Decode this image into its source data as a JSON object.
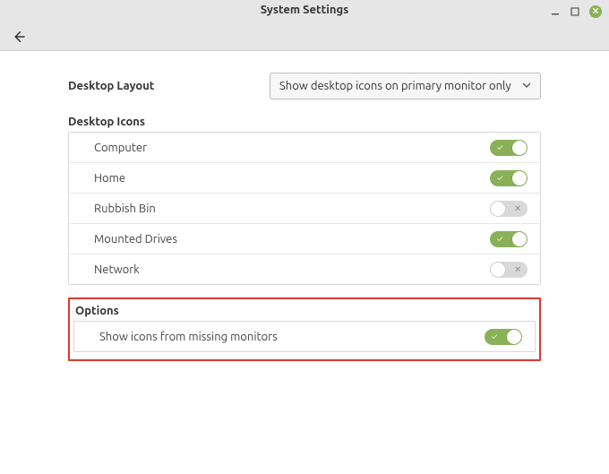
{
  "window": {
    "title": "System Settings"
  },
  "layout": {
    "label": "Desktop Layout",
    "select_value": "Show desktop icons on primary monitor only"
  },
  "desktop_icons": {
    "heading": "Desktop Icons",
    "items": [
      {
        "label": "Computer",
        "on": true
      },
      {
        "label": "Home",
        "on": true
      },
      {
        "label": "Rubbish Bin",
        "on": false
      },
      {
        "label": "Mounted Drives",
        "on": true
      },
      {
        "label": "Network",
        "on": false
      }
    ]
  },
  "options": {
    "heading": "Options",
    "items": [
      {
        "label": "Show icons from missing monitors",
        "on": true
      }
    ]
  }
}
